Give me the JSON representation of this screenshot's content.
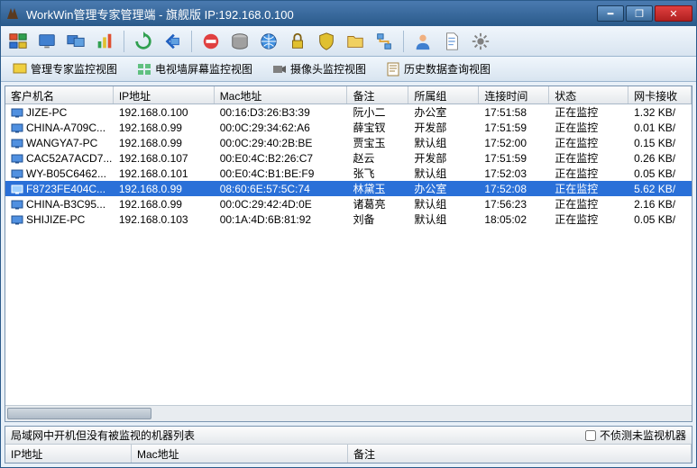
{
  "window": {
    "title": "WorkWin管理专家管理端 - 旗舰版 IP:192.168.0.100"
  },
  "toolbar2": {
    "tab1": "管理专家监控视图",
    "tab2": "电视墙屏幕监控视图",
    "tab3": "摄像头监控视图",
    "tab4": "历史数据查询视图"
  },
  "columns": {
    "name": "客户机名",
    "ip": "IP地址",
    "mac": "Mac地址",
    "note": "备注",
    "group": "所属组",
    "time": "连接时间",
    "status": "状态",
    "net": "网卡接收"
  },
  "rows": [
    {
      "name": "JIZE-PC",
      "ip": "192.168.0.100",
      "mac": "00:16:D3:26:B3:39",
      "note": "阮小二",
      "group": "办公室",
      "time": "17:51:58",
      "status": "正在监控",
      "net": "1.32 KB/",
      "sel": false
    },
    {
      "name": "CHINA-A709C...",
      "ip": "192.168.0.99",
      "mac": "00:0C:29:34:62:A6",
      "note": "薛宝钗",
      "group": "开发部",
      "time": "17:51:59",
      "status": "正在监控",
      "net": "0.01 KB/",
      "sel": false
    },
    {
      "name": "WANGYA7-PC",
      "ip": "192.168.0.99",
      "mac": "00:0C:29:40:2B:BE",
      "note": "贾宝玉",
      "group": "默认组",
      "time": "17:52:00",
      "status": "正在监控",
      "net": "0.15 KB/",
      "sel": false
    },
    {
      "name": "CAC52A7ACD7...",
      "ip": "192.168.0.107",
      "mac": "00:E0:4C:B2:26:C7",
      "note": "赵云",
      "group": "开发部",
      "time": "17:51:59",
      "status": "正在监控",
      "net": "0.26 KB/",
      "sel": false
    },
    {
      "name": "WY-B05C6462...",
      "ip": "192.168.0.101",
      "mac": "00:E0:4C:B1:BE:F9",
      "note": "张飞",
      "group": "默认组",
      "time": "17:52:03",
      "status": "正在监控",
      "net": "0.05 KB/",
      "sel": false
    },
    {
      "name": "F8723FE404C...",
      "ip": "192.168.0.99",
      "mac": "08:60:6E:57:5C:74",
      "note": "林黛玉",
      "group": "办公室",
      "time": "17:52:08",
      "status": "正在监控",
      "net": "5.62 KB/",
      "sel": true
    },
    {
      "name": "CHINA-B3C95...",
      "ip": "192.168.0.99",
      "mac": "00:0C:29:42:4D:0E",
      "note": "诸葛亮",
      "group": "默认组",
      "time": "17:56:23",
      "status": "正在监控",
      "net": "2.16 KB/",
      "sel": false
    },
    {
      "name": "SHIJIZE-PC",
      "ip": "192.168.0.103",
      "mac": "00:1A:4D:6B:81:92",
      "note": "刘备",
      "group": "默认组",
      "time": "18:05:02",
      "status": "正在监控",
      "net": "0.05 KB/",
      "sel": false
    }
  ],
  "bottom": {
    "title": "局域网中开机但没有被监视的机器列表",
    "checkbox": "不侦测未监视机器",
    "col_ip": "IP地址",
    "col_mac": "Mac地址",
    "col_note": "备注"
  }
}
